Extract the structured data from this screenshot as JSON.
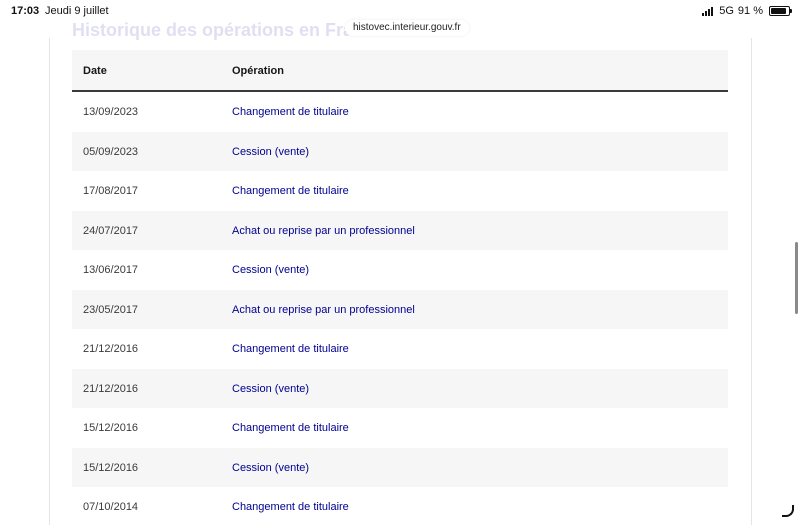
{
  "status_bar": {
    "time": "17:03",
    "date": "Jeudi 9 juillet",
    "network": "5G",
    "battery": "91 %"
  },
  "browser": {
    "url": "histovec.interieur.gouv.fr"
  },
  "page": {
    "heading_partial": "Historique des opérations en France"
  },
  "table": {
    "headers": {
      "date": "Date",
      "operation": "Opération"
    },
    "rows": [
      {
        "date": "13/09/2023",
        "operation": "Changement de titulaire"
      },
      {
        "date": "05/09/2023",
        "operation": "Cession (vente)"
      },
      {
        "date": "17/08/2017",
        "operation": "Changement de titulaire"
      },
      {
        "date": "24/07/2017",
        "operation": "Achat ou reprise par un professionnel"
      },
      {
        "date": "13/06/2017",
        "operation": "Cession (vente)"
      },
      {
        "date": "23/05/2017",
        "operation": "Achat ou reprise par un professionnel"
      },
      {
        "date": "21/12/2016",
        "operation": "Changement de titulaire"
      },
      {
        "date": "21/12/2016",
        "operation": "Cession (vente)"
      },
      {
        "date": "15/12/2016",
        "operation": "Changement de titulaire"
      },
      {
        "date": "15/12/2016",
        "operation": "Cession (vente)"
      },
      {
        "date": "07/10/2014",
        "operation": "Changement de titulaire"
      }
    ]
  },
  "colors": {
    "link": "#000091",
    "row_alt": "#f6f6f6",
    "header_border": "#3a3a3a"
  }
}
